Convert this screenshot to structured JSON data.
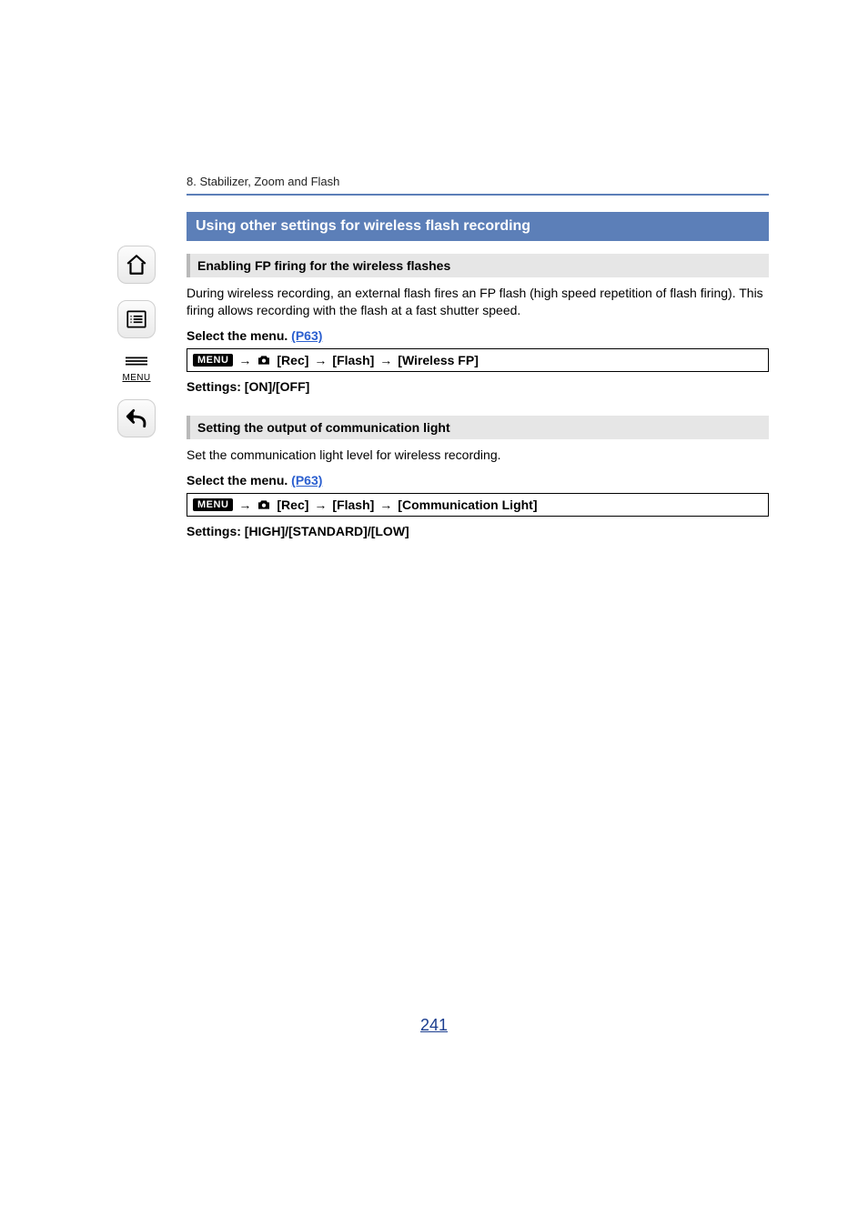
{
  "breadcrumb": "8. Stabilizer, Zoom and Flash",
  "section_title": "Using other settings for wireless flash recording",
  "blocks": [
    {
      "subhead": "Enabling FP firing for the wireless flashes",
      "para": "During wireless recording, an external flash fires an FP flash (high speed repetition of flash firing). This firing allows recording with the flash at a fast shutter speed.",
      "select_label": "Select the menu.",
      "select_link": "(P63)",
      "menu_badge": "MENU",
      "path": {
        "arrow": "→",
        "rec": "[Rec]",
        "flash": "[Flash]",
        "target": "[Wireless FP]"
      },
      "settings": "Settings: [ON]/[OFF]"
    },
    {
      "subhead": "Setting the output of communication light",
      "para": "Set the communication light level for wireless recording.",
      "select_label": "Select the menu.",
      "select_link": "(P63)",
      "menu_badge": "MENU",
      "path": {
        "arrow": "→",
        "rec": "[Rec]",
        "flash": "[Flash]",
        "target": "[Communication Light]"
      },
      "settings": "Settings: [HIGH]/[STANDARD]/[LOW]"
    }
  ],
  "sidenav": {
    "menu_label": "MENU"
  },
  "page_number": "241"
}
